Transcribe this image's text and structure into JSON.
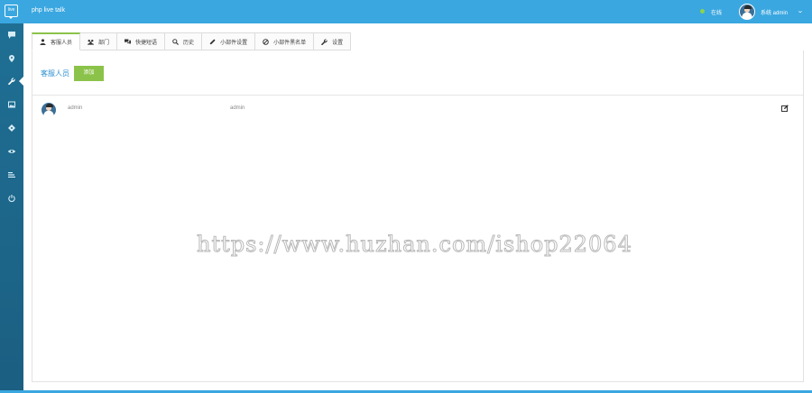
{
  "header": {
    "app_title": "php live talk",
    "logo_text": "live",
    "status_text": "在线",
    "user_name": "系统 admin"
  },
  "sidebar": {
    "items": [
      {
        "icon": "chat-icon"
      },
      {
        "icon": "location-icon"
      },
      {
        "icon": "wrench-icon",
        "active": true
      },
      {
        "icon": "image-icon"
      },
      {
        "icon": "tag-icon"
      },
      {
        "icon": "eye-icon"
      },
      {
        "icon": "list-icon"
      },
      {
        "icon": "power-icon"
      }
    ]
  },
  "tabs": [
    {
      "label": "客服人员",
      "icon": "user-icon",
      "active": true
    },
    {
      "label": "部门",
      "icon": "group-icon"
    },
    {
      "label": "快捷短语",
      "icon": "chat-bubbles-icon"
    },
    {
      "label": "历史",
      "icon": "search-icon"
    },
    {
      "label": "小部件设置",
      "icon": "pen-icon"
    },
    {
      "label": "小部件黑名单",
      "icon": "ban-icon"
    },
    {
      "label": "设置",
      "icon": "wrench-icon"
    }
  ],
  "main": {
    "section_label": "客服人员",
    "add_button": "添加",
    "rows": [
      {
        "name": "admin",
        "login": "admin"
      }
    ]
  },
  "watermark": "https://www.huzhan.com/ishop22064",
  "colors": {
    "header": "#3aa7e0",
    "sidebar": "#1f6f94",
    "accent_green": "#8bc34a",
    "link_blue": "#2d8fcf"
  }
}
